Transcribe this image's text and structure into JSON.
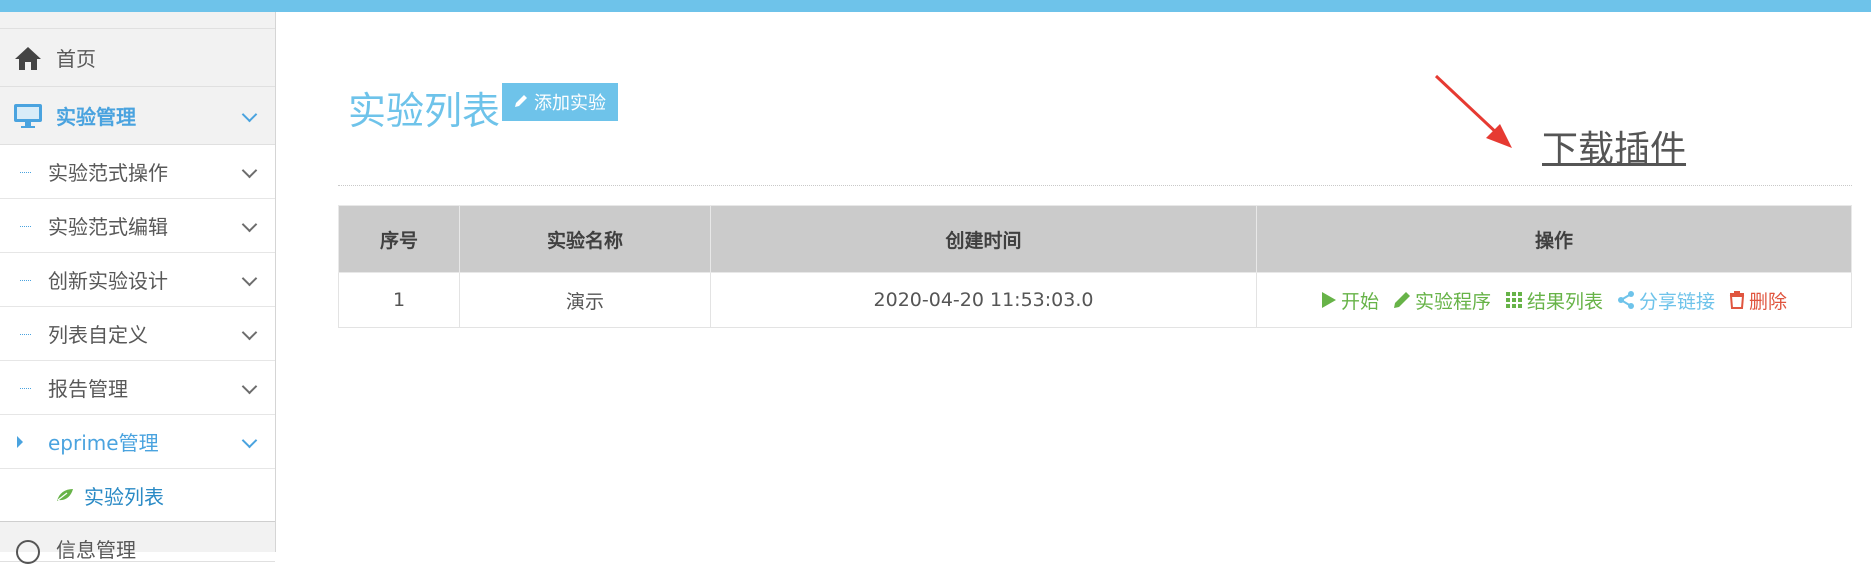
{
  "sidebar": {
    "home": "首页",
    "experiment_mgmt": "实验管理",
    "sub_items": [
      "实验范式操作",
      "实验范式编辑",
      "创新实验设计",
      "列表自定义",
      "报告管理",
      "eprime管理"
    ],
    "subsub_item": "实验列表",
    "bottom_partial": "信息管理"
  },
  "main": {
    "title": "实验列表",
    "add_button": "添加实验",
    "download_link": "下载插件",
    "table": {
      "headers": [
        "序号",
        "实验名称",
        "创建时间",
        "操作"
      ],
      "rows": [
        {
          "index": "1",
          "name": "演示",
          "created": "2020-04-20 11:53:03.0"
        }
      ],
      "actions": {
        "start": "开始",
        "program": "实验程序",
        "results": "结果列表",
        "share": "分享链接",
        "delete": "删除"
      }
    }
  },
  "colors": {
    "accent": "#6ec3ea",
    "green": "#67b348",
    "red": "#e0553f",
    "annotation_arrow": "#e63a32"
  }
}
